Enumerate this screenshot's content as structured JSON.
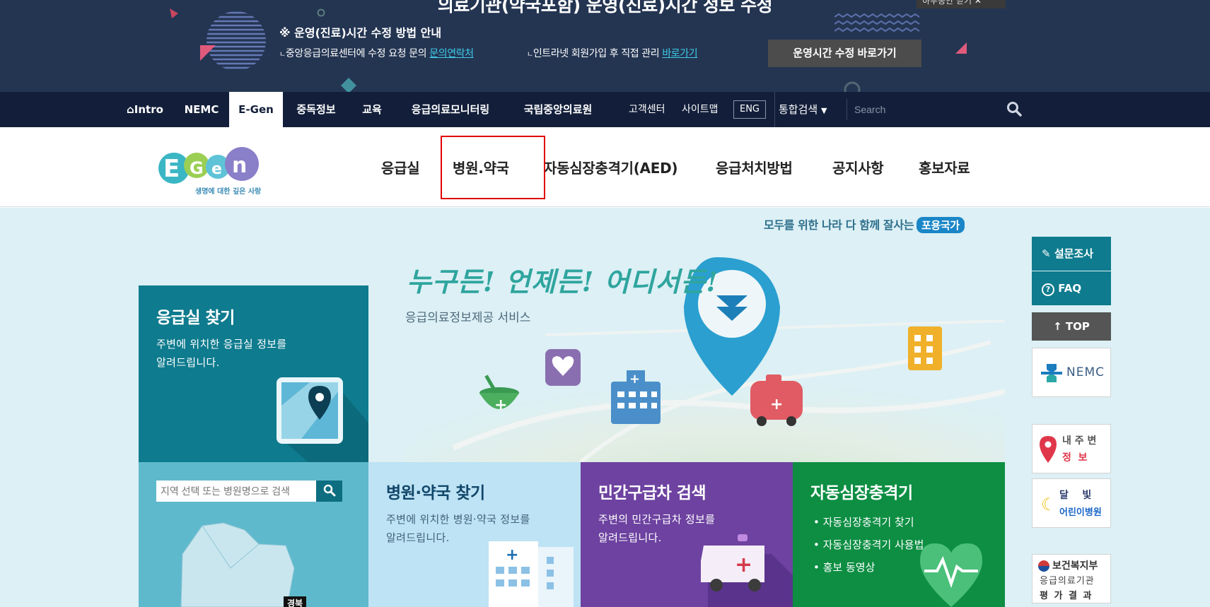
{
  "notice": {
    "title": "의료기관(약국포함) 운영(진료)시간 정보 수정",
    "subtitle": "※ 운영(진료)시간 수정 방법 안내",
    "line1_prefix": "중앙응급의료센터에 수정 요청 문의",
    "line1_link": "문의연락처",
    "line2_prefix": "인트라넷 회원가입 후 직접 관리",
    "line2_link": "바로가기",
    "button_label": "운영시간 수정 바로가기",
    "close_label": "하루동안 닫기"
  },
  "gnb": {
    "items": [
      "Intro",
      "NEMC",
      "E-Gen",
      "중독정보",
      "교육",
      "응급의료모니터링",
      "국립중앙의료원"
    ],
    "active": "E-Gen",
    "util": [
      "고객센터",
      "사이트맵"
    ],
    "eng_label": "ENG",
    "search_scope": "통합검색",
    "search_placeholder": "Search"
  },
  "subnav": {
    "logo_tagline": "생명에 대한 깊은 사랑",
    "items": [
      "응급실",
      "병원.약국",
      "자동심장충격기(AED)",
      "응급처치방법",
      "공지사항",
      "홍보자료"
    ]
  },
  "slogan": {
    "text": "모두를 위한 나라 다 함께 잘사는",
    "badge": "포용국가"
  },
  "hero": {
    "title": "누구든! 언제든! 어디서든!",
    "subtitle": "응급의료정보제공 서비스"
  },
  "tiles": {
    "er": {
      "title": "응급실 찾기",
      "desc1": "주변에 위치한 응급실 정보를",
      "desc2": "알려드립니다."
    },
    "region": {
      "placeholder": "지역 선택 또는 병원명으로 검색",
      "map_label": "경북"
    },
    "hospital": {
      "title": "병원·약국 찾기",
      "desc1": "주변에 위치한 병원·약국 정보를",
      "desc2": "알려드립니다."
    },
    "ambulance": {
      "title": "민간구급차 검색",
      "desc1": "주변의 민간구급차 정보를",
      "desc2": "알려드립니다."
    },
    "aed": {
      "title": "자동심장충격기",
      "items": [
        "자동심장충격기 찾기",
        "자동심장충격기 사용법",
        "홍보 동영상"
      ]
    }
  },
  "quick": {
    "survey": "설문조사",
    "faq": "FAQ",
    "top": "TOP",
    "nemc": "NEMC",
    "near_line1": "내 주 변",
    "near_line2": "정  보",
    "moon_line1": "달    빛",
    "moon_line2": "어린이병원",
    "mohw_line1": "보건복지부",
    "mohw_line2": "응급의료기관",
    "mohw_line3": "평 가 결 과"
  },
  "colors": {
    "nav_bg": "#131f3a",
    "notice_bg": "#243552",
    "teal": "#0e7b8e",
    "purple": "#6d42a0",
    "green": "#0d8e43",
    "highlight": "#e00000"
  }
}
